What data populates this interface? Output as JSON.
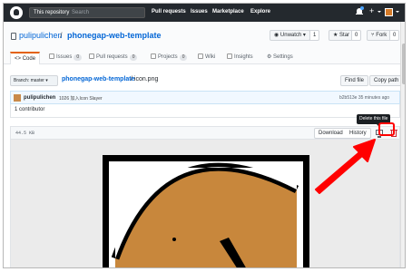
{
  "topbar": {
    "scope": "This repository",
    "search_placeholder": "Search",
    "nav": [
      "Pull requests",
      "Issues",
      "Marketplace",
      "Explore"
    ]
  },
  "repo": {
    "owner": "pulipulichen",
    "separator": "/",
    "name": "phonegap-web-template",
    "watch_label": "Unwatch",
    "watch_count": "1",
    "star_label": "Star",
    "star_count": "0",
    "fork_label": "Fork",
    "fork_count": "0"
  },
  "tabs": [
    {
      "label": "Code"
    },
    {
      "label": "Issues",
      "count": "0"
    },
    {
      "label": "Pull requests",
      "count": "0"
    },
    {
      "label": "Projects",
      "count": "0"
    },
    {
      "label": "Wiki"
    },
    {
      "label": "Insights"
    },
    {
      "label": "Settings"
    }
  ],
  "file": {
    "branch_label": "Branch: master",
    "breadcrumb_repo": "phonegap-web-template",
    "breadcrumb_file": "/ icon.png",
    "find_file": "Find file",
    "copy_path": "Copy path",
    "commit_user": "pulipulichen",
    "commit_message": "1026 加入Icon Slayer",
    "commit_info": "b2b513e 35 minutes ago",
    "contributors": "1 contributor",
    "size": "44.5 KB",
    "download": "Download",
    "history": "History",
    "tooltip": "Delete this file"
  },
  "colors": {
    "topbar": "#24292e",
    "link": "#0366d6",
    "danger": "#cb2431",
    "highlight": "#ff0000",
    "icon_image": "#c8873c"
  },
  "icons": [
    "github-logo-icon",
    "bell-icon",
    "plus-icon",
    "repo-icon",
    "monitor-icon",
    "trash-icon"
  ]
}
